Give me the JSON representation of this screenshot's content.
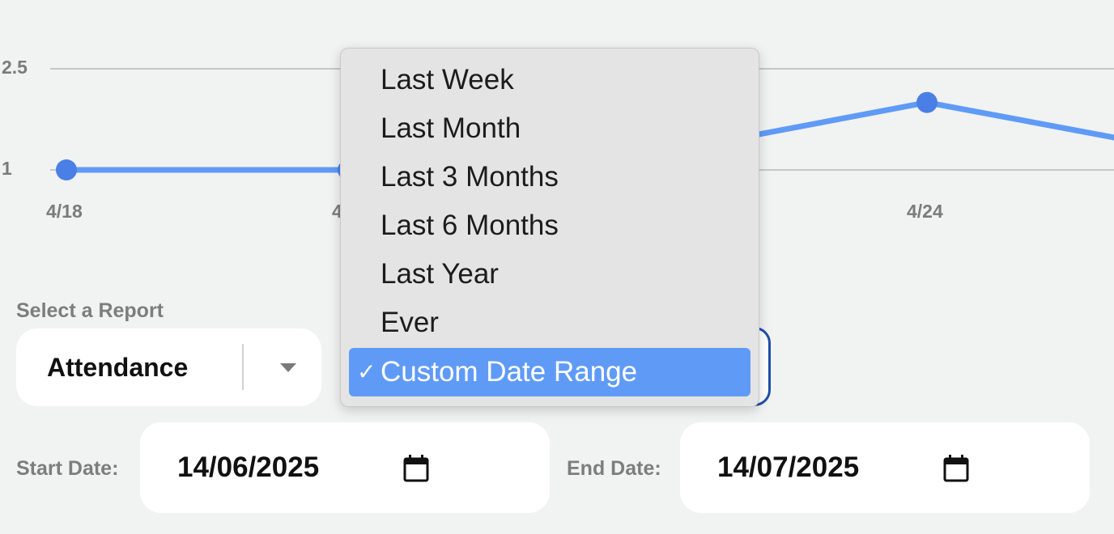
{
  "chart_data": {
    "type": "line",
    "x_tick_labels": [
      "4/18",
      "4",
      "4/24"
    ],
    "y_ticks": [
      1,
      2.5
    ],
    "y_tick_labels": [
      "1",
      "2.5"
    ],
    "series": [
      {
        "values": [
          1,
          1,
          1.5,
          2
        ]
      }
    ],
    "grid": true,
    "colors": {
      "line": "#5f9bf6",
      "point": "#4a7fe6"
    }
  },
  "report": {
    "label": "Select a Report",
    "value": "Attendance"
  },
  "period_menu": {
    "items": [
      {
        "label": "Last Week",
        "selected": false
      },
      {
        "label": "Last Month",
        "selected": false
      },
      {
        "label": "Last 3 Months",
        "selected": false
      },
      {
        "label": "Last 6 Months",
        "selected": false
      },
      {
        "label": "Last Year",
        "selected": false
      },
      {
        "label": "Ever",
        "selected": false
      },
      {
        "label": "Custom Date Range",
        "selected": true
      }
    ],
    "check_mark": "✓"
  },
  "start_date": {
    "label": "Start Date:",
    "value": "14/06/2025"
  },
  "end_date": {
    "label": "End Date:",
    "value": "14/07/2025"
  },
  "icons": {
    "calendar": "calendar-icon",
    "caret": "chevron-down-icon"
  },
  "colors": {
    "background": "#f1f2f2",
    "accent": "#5f9bf6",
    "focus_border": "#1f4fa8"
  }
}
